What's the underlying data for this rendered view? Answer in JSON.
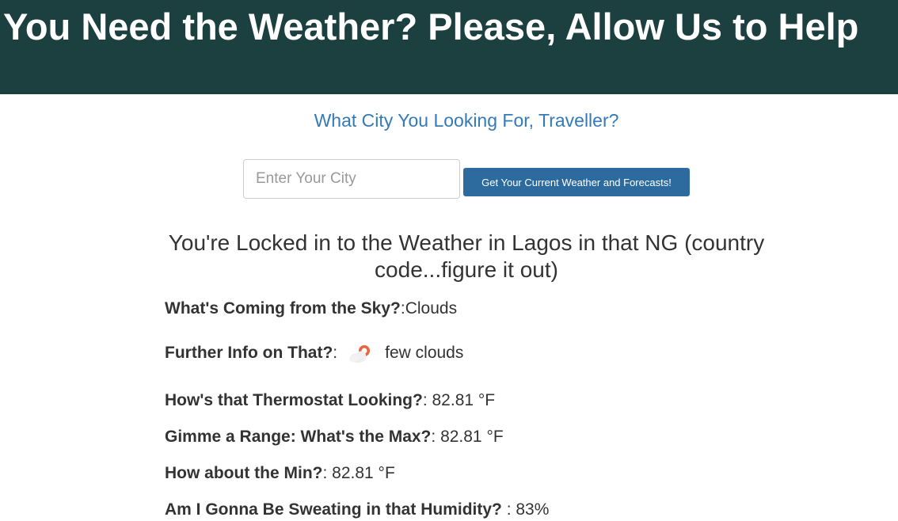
{
  "header": {
    "title": "You Need the Weather? Please, Allow Us to Help"
  },
  "search": {
    "prompt": "What City You Looking For, Traveller?",
    "placeholder": "Enter Your City",
    "value": "",
    "button_label": "Get Your Current Weather and Forecasts!"
  },
  "result": {
    "locked_text": "You're Locked in to the Weather in Lagos in that NG (country code...figure it out)",
    "rows": [
      {
        "label": "What's Coming from the Sky?",
        "sep": ":",
        "value": "Clouds"
      },
      {
        "label": "Further Info on That?",
        "sep": ":",
        "value": "few clouds",
        "icon": "few-clouds-icon"
      },
      {
        "label": "How's that Thermostat Looking?",
        "sep": ": ",
        "value": "82.81 °F"
      },
      {
        "label": "Gimme a Range: What's the Max?",
        "sep": ": ",
        "value": "82.81 °F"
      },
      {
        "label": "How about the Min?",
        "sep": ": ",
        "value": "82.81 °F"
      },
      {
        "label": "Am I Gonna Be Sweating in that Humidity?",
        "sep": " : ",
        "value": "83%"
      }
    ]
  },
  "colors": {
    "header_bg": "#1c3f3f",
    "prompt": "#337ab7",
    "button_bg": "#2d6b9f",
    "sun": "#e8643c"
  }
}
